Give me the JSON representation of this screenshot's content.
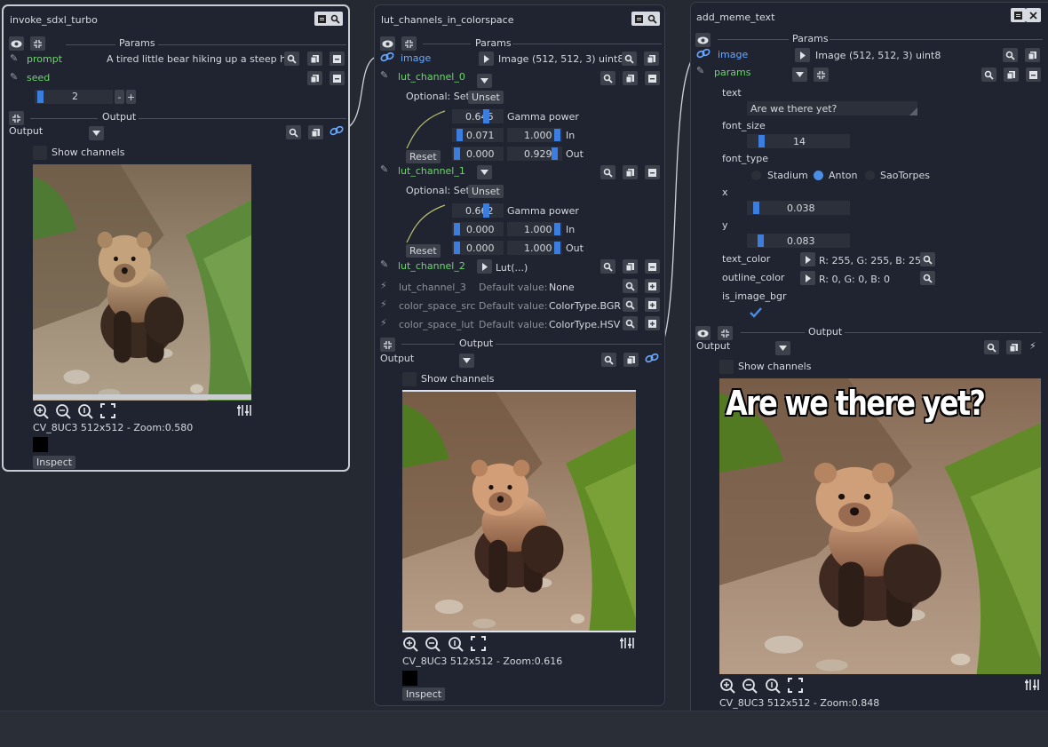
{
  "nodes": {
    "n1": {
      "title": "invoke_sdxl_turbo",
      "params_label": "Params",
      "prompt_label": "prompt",
      "prompt_value": "A tired little bear hiking up a steep hi...",
      "seed_label": "seed",
      "seed_value": "2",
      "minus": "-",
      "plus": "+",
      "output_label": "Output",
      "output_select": "Output",
      "show_channels": "Show channels",
      "info": "CV_8UC3 512x512 - Zoom:0.580",
      "inspect": "Inspect"
    },
    "n2": {
      "title": "lut_channels_in_colorspace",
      "params_label": "Params",
      "image_label": "image",
      "image_value": "Image (512, 512, 3) uint8",
      "lut0_label": "lut_channel_0",
      "optional_set": "Optional: Set",
      "unset": "Unset",
      "gamma_power": "Gamma power",
      "lut0_gamma": "0.646",
      "lut0_in_min": "0.071",
      "lut0_in_max": "1.000",
      "lut0_out_min": "0.000",
      "lut0_out_max": "0.929",
      "in_label": "In",
      "out_label": "Out",
      "reset": "Reset",
      "lut1_label": "lut_channel_1",
      "lut1_gamma": "0.662",
      "lut1_in_min": "0.000",
      "lut1_in_max": "1.000",
      "lut1_out_min": "0.000",
      "lut1_out_max": "1.000",
      "lut2_label": "lut_channel_2",
      "lut2_value": "Lut(...)",
      "lut3_label": "lut_channel_3",
      "default_value": "Default value:",
      "lut3_value": "None",
      "css_label": "color_space_src",
      "css_value": "ColorType.BGR",
      "csl_label": "color_space_lut",
      "csl_value": "ColorType.HSV",
      "output_label": "Output",
      "output_select": "Output",
      "show_channels": "Show channels",
      "info": "CV_8UC3 512x512 - Zoom:0.616",
      "inspect": "Inspect"
    },
    "n3": {
      "title": "add_meme_text",
      "params_label": "Params",
      "image_label": "image",
      "image_value": "Image (512, 512, 3) uint8",
      "params_sub": "params",
      "text_label": "text",
      "text_value": "Are we there yet?",
      "font_size_label": "font_size",
      "font_size_value": "14",
      "font_type_label": "font_type",
      "font_options": [
        "Stadium",
        "Anton",
        "SaoTorpes"
      ],
      "x_label": "x",
      "x_value": "0.038",
      "y_label": "y",
      "y_value": "0.083",
      "text_color_label": "text_color",
      "text_color_value": "R: 255, G: 255, B: 255",
      "outline_color_label": "outline_color",
      "outline_color_value": "R: 0, G: 0, B: 0",
      "is_image_bgr_label": "is_image_bgr",
      "output_label": "Output",
      "output_select": "Output",
      "show_channels": "Show channels",
      "meme_caption": "Are we there yet?",
      "info": "CV_8UC3 512x512 - Zoom:0.848"
    }
  },
  "colors": {
    "background": "#252932",
    "node": "#202430",
    "accent_blue": "#3b7ee0",
    "param_green": "#6fd36f",
    "link_blue": "#6aa8ff"
  }
}
